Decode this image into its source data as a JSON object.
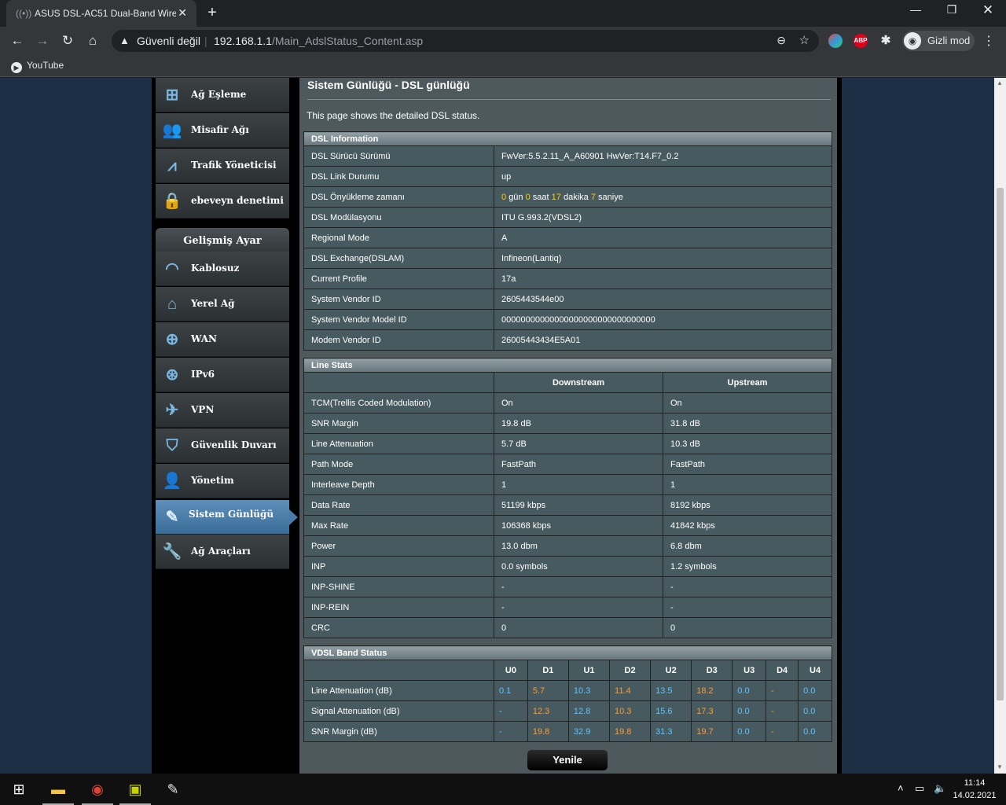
{
  "browser": {
    "tab_title": "ASUS DSL-AC51 Dual-Band Wirel",
    "security_label": "Güvenli değil",
    "url_host": "192.168.1.1",
    "url_path": "/Main_AdslStatus_Content.asp",
    "incognito_label": "Gizli mod",
    "abp_label": "ABP",
    "bookmarks": [
      "YouTube"
    ]
  },
  "sidebar": {
    "top_items": [
      {
        "label": "Ağ Eşleme",
        "icon": "network-map-icon"
      },
      {
        "label": "Misafir Ağı",
        "icon": "guest-network-icon"
      },
      {
        "label": "Trafik Yöneticisi",
        "icon": "traffic-manager-icon"
      },
      {
        "label": "ebeveyn denetimi",
        "icon": "parental-control-icon"
      }
    ],
    "advanced_header": "Gelişmiş Ayar",
    "advanced_items": [
      {
        "label": "Kablosuz",
        "icon": "wireless-icon"
      },
      {
        "label": "Yerel Ağ",
        "icon": "lan-icon"
      },
      {
        "label": "WAN",
        "icon": "wan-icon"
      },
      {
        "label": "IPv6",
        "icon": "ipv6-icon"
      },
      {
        "label": "VPN",
        "icon": "vpn-icon"
      },
      {
        "label": "Güvenlik Duvarı",
        "icon": "firewall-icon"
      },
      {
        "label": "Yönetim",
        "icon": "administration-icon"
      },
      {
        "label": "Sistem Günlüğü",
        "icon": "system-log-icon",
        "active": true
      },
      {
        "label": "Ağ Araçları",
        "icon": "network-tools-icon"
      }
    ]
  },
  "main": {
    "title": "Sistem Günlüğü - DSL günlüğü",
    "description": "This page shows the detailed DSL status.",
    "dsl_info": {
      "header": "DSL Information",
      "rows": [
        {
          "label": "DSL Sürücü Sürümü",
          "value": "FwVer:5.5.2.11_A_A60901 HwVer:T14.F7_0.2"
        },
        {
          "label": "DSL Link Durumu",
          "value": "up"
        },
        {
          "label": "DSL Önyükleme zamanı",
          "uptime": {
            "days": "0",
            "days_unit": "gün",
            "hours": "0",
            "hours_unit": "saat",
            "minutes": "17",
            "minutes_unit": "dakika",
            "seconds": "7",
            "seconds_unit": "saniye"
          }
        },
        {
          "label": "DSL Modülasyonu",
          "value": "ITU G.993.2(VDSL2)"
        },
        {
          "label": "Regional Mode",
          "value": "A"
        },
        {
          "label": "DSL Exchange(DSLAM)",
          "value": "Infineon(Lantiq)"
        },
        {
          "label": "Current Profile",
          "value": "17a"
        },
        {
          "label": "System Vendor ID",
          "value": "2605443544e00"
        },
        {
          "label": "System Vendor Model ID",
          "value": "00000000000000000000000000000000"
        },
        {
          "label": "Modem Vendor ID",
          "value": "26005443434E5A01"
        }
      ]
    },
    "line_stats": {
      "header": "Line Stats",
      "col_downstream": "Downstream",
      "col_upstream": "Upstream",
      "rows": [
        {
          "label": "TCM(Trellis Coded Modulation)",
          "down": "On",
          "up": "On"
        },
        {
          "label": "SNR Margin",
          "down": "19.8 dB",
          "up": "31.8 dB"
        },
        {
          "label": "Line Attenuation",
          "down": "5.7 dB",
          "up": "10.3 dB"
        },
        {
          "label": "Path Mode",
          "down": "FastPath",
          "up": "FastPath"
        },
        {
          "label": "Interleave Depth",
          "down": "1",
          "up": "1"
        },
        {
          "label": "Data Rate",
          "down": "51199 kbps",
          "up": "8192 kbps"
        },
        {
          "label": "Max Rate",
          "down": "106368 kbps",
          "up": "41842 kbps"
        },
        {
          "label": "Power",
          "down": "13.0 dbm",
          "up": "6.8 dbm"
        },
        {
          "label": "INP",
          "down": "0.0 symbols",
          "up": "1.2 symbols"
        },
        {
          "label": "INP-SHINE",
          "down": "-",
          "up": "-"
        },
        {
          "label": "INP-REIN",
          "down": "-",
          "up": "-"
        },
        {
          "label": "CRC",
          "down": "0",
          "up": "0"
        }
      ]
    },
    "vdsl_band": {
      "header": "VDSL Band Status",
      "columns": [
        "U0",
        "D1",
        "U1",
        "D2",
        "U2",
        "D3",
        "U3",
        "D4",
        "U4"
      ],
      "rows": [
        {
          "label": "Line Attenuation (dB)",
          "values": [
            "0.1",
            "5.7",
            "10.3",
            "11.4",
            "13.5",
            "18.2",
            "0.0",
            "-",
            "0.0"
          ]
        },
        {
          "label": "Signal Attenuation (dB)",
          "values": [
            "-",
            "12.3",
            "12.8",
            "10.3",
            "15.6",
            "17.3",
            "0.0",
            "-",
            "0.0"
          ]
        },
        {
          "label": "SNR Margin (dB)",
          "values": [
            "-",
            "19.8",
            "32.9",
            "19.8",
            "31.3",
            "19.7",
            "0.0",
            "-",
            "0.0"
          ]
        }
      ],
      "upstream_color": "#5ec3ff",
      "downstream_color": "#ff9933"
    },
    "refresh_label": "Yenile"
  },
  "taskbar": {
    "time": "11:14",
    "date": "14.02.2021"
  }
}
